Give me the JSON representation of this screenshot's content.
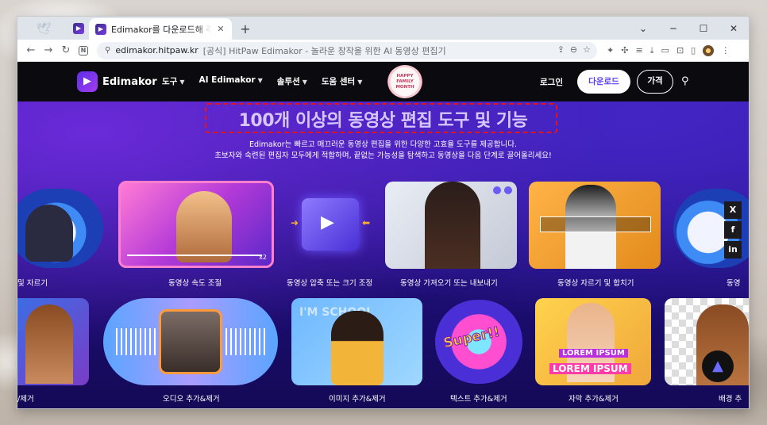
{
  "browser": {
    "tab_title": "Edimakor를 다운로드해 주셔서",
    "new_tab_symbol": "+",
    "url": "edimakor.hitpaw.kr",
    "page_title": "[공식] HitPaw Edimakor - 놀라운 창작을 위한 AI 동영상 편집기",
    "controls": {
      "minimize": "─",
      "maximize": "☐",
      "close": "✕",
      "tablist": "⌄"
    }
  },
  "site": {
    "logo_text": "Edimakor",
    "menu": [
      "도구",
      "AI Edimakor",
      "솔루션",
      "도움 센터"
    ],
    "promo_badge": "HAPPY FAMILY MONTH",
    "login": "로그인",
    "download": "다운로드",
    "pricing": "가격"
  },
  "hero": {
    "headline": "100개 이상의 동영상 편집 도구 및 기능",
    "subtitle_1": "Edimakor는 빠르고 매끄러운 동영상 편집을 위한 다양한 고효율 도구를 제공합니다.",
    "subtitle_2": "초보자와 숙련된 편집자 모두에게 적합하며, 끝없는 가능성을 탐색하고 동영상을 다음 단계로 끌어올리세요!"
  },
  "row1": [
    "및 자르기",
    "동영상 속도 조절",
    "동영상 압축 또는 크기 조정",
    "동영상 가져오기 또는 내보내기",
    "동영상 자르기 및 합치기",
    "동영"
  ],
  "row2": [
    "/제거",
    "오디오 추가&제거",
    "이미지 추가&제거",
    "텍스트 추가&제거",
    "자막 추가&제거",
    "배경 추"
  ],
  "card_text": {
    "speed_badge": "x2",
    "text_sticker": "Super!!",
    "lorem_1": "LOREM IPSUM",
    "lorem_2": "LOREM IPSUM",
    "school": "I'M SCHOOL"
  },
  "social": [
    "X",
    "f",
    "in"
  ],
  "colors": {
    "accent": "#5b3df0",
    "highlight_border": "#e0161f",
    "headline": "#d7c7ff"
  }
}
